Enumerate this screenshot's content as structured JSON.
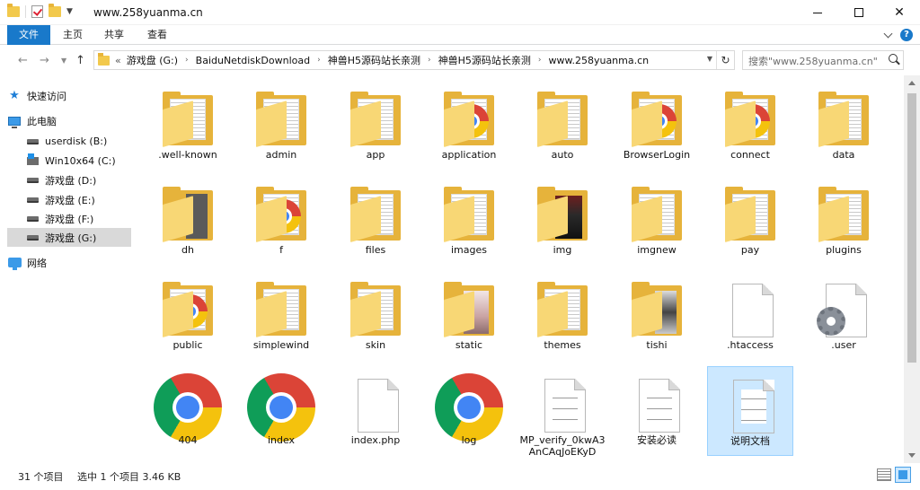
{
  "window": {
    "title": "www.258yuanma.cn"
  },
  "ribbon": {
    "tabs": [
      "文件",
      "主页",
      "共享",
      "查看"
    ]
  },
  "address": {
    "prefix": "«",
    "segments": [
      "游戏盘 (G:)",
      "BaiduNetdiskDownload",
      "神兽H5源码站长亲测",
      "神兽H5源码站长亲测",
      "www.258yuanma.cn"
    ],
    "separator": "›"
  },
  "search": {
    "placeholder": "搜索\"www.258yuanma.cn\""
  },
  "nav": {
    "items": [
      {
        "label": "快速访问",
        "icon": "star-icon"
      },
      {
        "label": "此电脑",
        "icon": "pc-icon"
      },
      {
        "label": "userdisk (B:)",
        "icon": "drive-icon"
      },
      {
        "label": "Win10x64 (C:)",
        "icon": "windows-drive-icon"
      },
      {
        "label": "游戏盘 (D:)",
        "icon": "drive-icon"
      },
      {
        "label": "游戏盘 (E:)",
        "icon": "drive-icon"
      },
      {
        "label": "游戏盘 (F:)",
        "icon": "drive-icon"
      },
      {
        "label": "游戏盘 (G:)",
        "icon": "drive-icon"
      },
      {
        "label": "网络",
        "icon": "network-icon"
      }
    ]
  },
  "files": [
    {
      "name": ".well-known",
      "icon": "folder"
    },
    {
      "name": "admin",
      "icon": "folder"
    },
    {
      "name": "app",
      "icon": "folder"
    },
    {
      "name": "application",
      "icon": "folder-chrome"
    },
    {
      "name": "auto",
      "icon": "folder"
    },
    {
      "name": "BrowserLogin",
      "icon": "folder-chrome"
    },
    {
      "name": "connect",
      "icon": "folder-chrome"
    },
    {
      "name": "data",
      "icon": "folder"
    },
    {
      "name": "dh",
      "icon": "folder-dark"
    },
    {
      "name": "f",
      "icon": "folder-chrome"
    },
    {
      "name": "files",
      "icon": "folder"
    },
    {
      "name": "images",
      "icon": "folder"
    },
    {
      "name": "img",
      "icon": "folder-photo"
    },
    {
      "name": "imgnew",
      "icon": "folder"
    },
    {
      "name": "pay",
      "icon": "folder"
    },
    {
      "name": "plugins",
      "icon": "folder"
    },
    {
      "name": "public",
      "icon": "folder-chrome"
    },
    {
      "name": "simplewind",
      "icon": "folder"
    },
    {
      "name": "skin",
      "icon": "folder"
    },
    {
      "name": "static",
      "icon": "folder-photo2"
    },
    {
      "name": "themes",
      "icon": "folder"
    },
    {
      "name": "tishi",
      "icon": "folder-photo3"
    },
    {
      "name": ".htaccess",
      "icon": "document"
    },
    {
      "name": ".user",
      "icon": "gear-document"
    },
    {
      "name": "404",
      "icon": "chrome"
    },
    {
      "name": "index",
      "icon": "chrome"
    },
    {
      "name": "index.php",
      "icon": "document"
    },
    {
      "name": "log",
      "icon": "chrome"
    },
    {
      "name": "MP_verify_0kwA3AnCAqJoEKyD",
      "icon": "document-lines"
    },
    {
      "name": "安装必读",
      "icon": "document-lines"
    },
    {
      "name": "说明文档",
      "icon": "document-lines",
      "selected": true
    }
  ],
  "status": {
    "count": "31 个项目",
    "selection": "选中 1 个项目  3.46 KB"
  },
  "colors": {
    "accent": "#1979ca",
    "folder": "#f8d775",
    "selection": "#cce8ff"
  }
}
